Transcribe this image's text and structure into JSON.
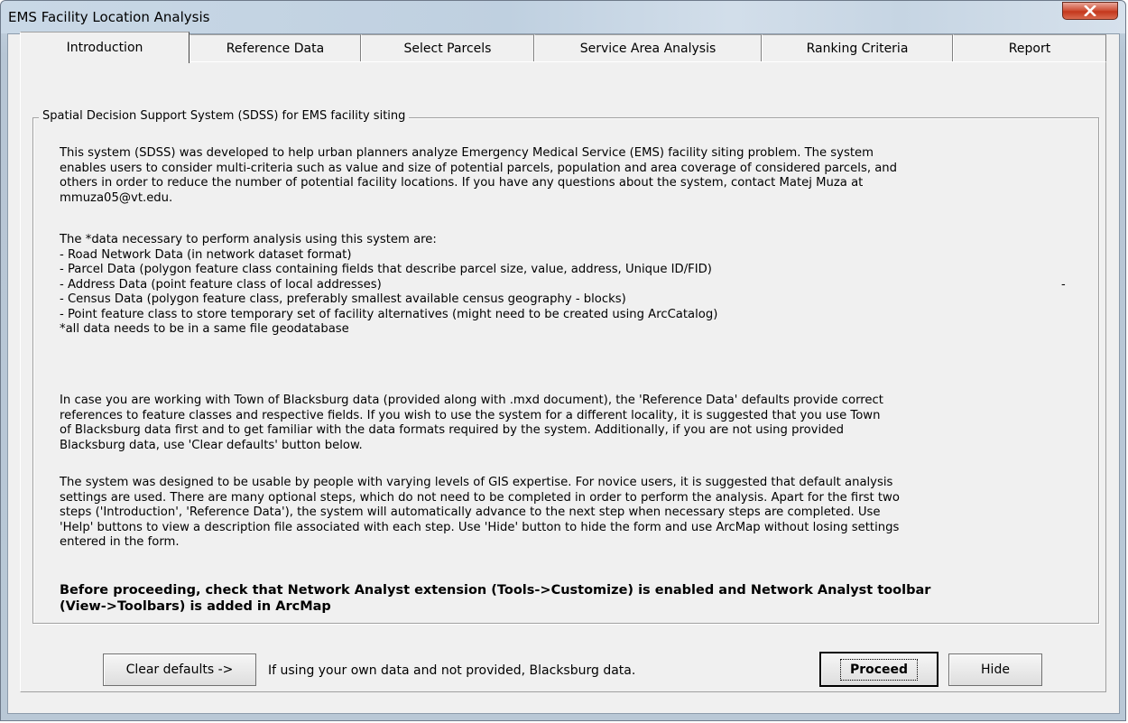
{
  "window": {
    "title": "EMS Facility Location Analysis"
  },
  "tabs": [
    {
      "label": "Introduction",
      "active": true
    },
    {
      "label": "Reference Data"
    },
    {
      "label": "Select Parcels"
    },
    {
      "label": "Service Area Analysis"
    },
    {
      "label": "Ranking Criteria"
    },
    {
      "label": "Report"
    }
  ],
  "group": {
    "label": "Spatial Decision Support System (SDSS) for EMS facility siting"
  },
  "intro": {
    "lines": [
      "This system (SDSS) was developed to help urban planners analyze Emergency Medical Service (EMS) facility siting problem. The system",
      "enables users to consider multi-criteria such as value and size of potential parcels, population and area coverage of considered parcels, and",
      "others in order to reduce the number of potential facility locations. If you have any questions about the system, contact Matej Muza at",
      "mmuza05@vt.edu."
    ]
  },
  "data_req": {
    "lines": [
      "The *data necessary to perform analysis using this system are:",
      "- Road Network Data (in network dataset format)",
      "- Parcel Data (polygon feature class containing fields that describe parcel size, value, address, Unique ID/FID)",
      "- Address Data (point feature class of local addresses)",
      "- Census Data (polygon feature class, preferably smallest available census geography - blocks)",
      "- Point feature class to store temporary set of facility alternatives (might need to be created using ArcCatalog)",
      "*all data needs to be in a same file geodatabase"
    ],
    "stray_dash": "-"
  },
  "blacksburg": {
    "lines": [
      "In case you are working with Town of Blacksburg data (provided along with .mxd document), the 'Reference Data' defaults provide correct",
      "references to feature classes and respective fields. If you wish to use the system for a different locality, it is suggested that you use Town",
      "of Blacksburg data first and to get familiar with the data formats required by the system. Additionally, if you are not using provided",
      "Blacksburg data, use 'Clear defaults' button below."
    ]
  },
  "usage": {
    "lines": [
      "The system was designed to be usable by people with varying levels of GIS expertise. For novice users, it is suggested that default analysis",
      "settings are used. There are many optional steps, which do not need to be completed in order to perform the analysis. Apart for the first two",
      "steps ('Introduction', 'Reference Data'), the system will automatically advance to the next step when necessary steps are completed. Use",
      "'Help' buttons to view a description file associated with each step. Use 'Hide' button to hide the form and use ArcMap without losing settings",
      "entered in the form."
    ]
  },
  "warning": {
    "lines": [
      "Before proceeding, check that Network Analyst extension (Tools->Customize) is enabled and Network Analyst toolbar",
      "(View->Toolbars) is added in ArcMap"
    ]
  },
  "footer": {
    "clear_defaults_label": "Clear defaults ->",
    "hint": "If using your own data and not provided, Blacksburg data.",
    "proceed_label": "Proceed",
    "hide_label": "Hide"
  }
}
